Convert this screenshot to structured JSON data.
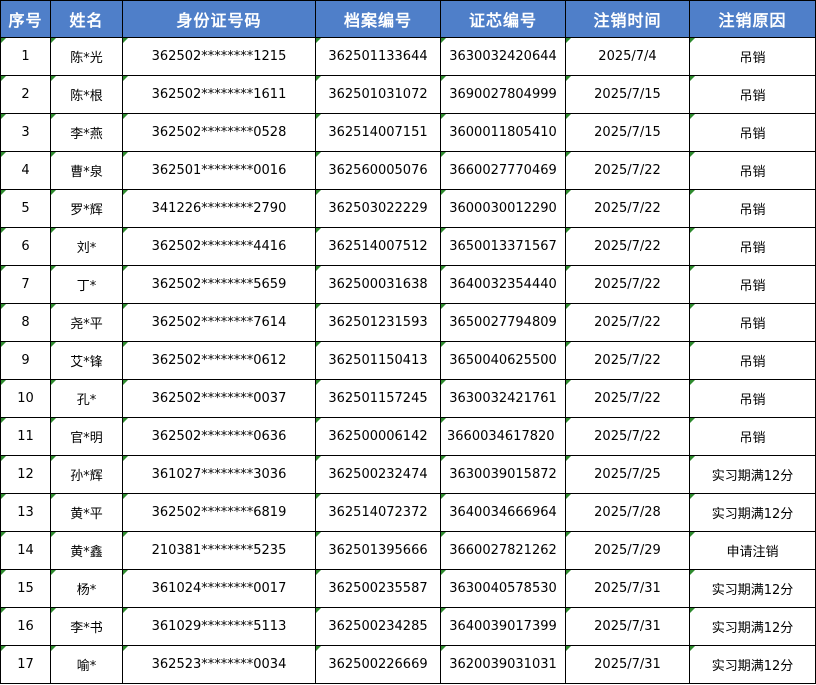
{
  "headers": [
    "序号",
    "姓名",
    "身份证号码",
    "档案编号",
    "证芯编号",
    "注销时间",
    "注销原因"
  ],
  "rows": [
    {
      "no": "1",
      "name": "陈*光",
      "id": "362502********1215",
      "file": "362501133644",
      "chip": "3630032420644",
      "date": "2025/7/4",
      "reason": "吊销"
    },
    {
      "no": "2",
      "name": "陈*根",
      "id": "362502********1611",
      "file": "362501031072",
      "chip": "3690027804999",
      "date": "2025/7/15",
      "reason": "吊销"
    },
    {
      "no": "3",
      "name": "李*燕",
      "id": "362502********0528",
      "file": "362514007151",
      "chip": "3600011805410",
      "date": "2025/7/15",
      "reason": "吊销"
    },
    {
      "no": "4",
      "name": "曹*泉",
      "id": "362501********0016",
      "file": "362560005076",
      "chip": "3660027770469",
      "date": "2025/7/22",
      "reason": "吊销"
    },
    {
      "no": "5",
      "name": "罗*辉",
      "id": "341226********2790",
      "file": "362503022229",
      "chip": "3600030012290",
      "date": "2025/7/22",
      "reason": "吊销"
    },
    {
      "no": "6",
      "name": "刘*",
      "id": "362502********4416",
      "file": "362514007512",
      "chip": "3650013371567",
      "date": "2025/7/22",
      "reason": "吊销"
    },
    {
      "no": "7",
      "name": "丁*",
      "id": "362502********5659",
      "file": "362500031638",
      "chip": "3640032354440",
      "date": "2025/7/22",
      "reason": "吊销"
    },
    {
      "no": "8",
      "name": "尧*平",
      "id": "362502********7614",
      "file": "362501231593",
      "chip": "3650027794809",
      "date": "2025/7/22",
      "reason": "吊销"
    },
    {
      "no": "9",
      "name": "艾*锋",
      "id": "362502********0612",
      "file": "362501150413",
      "chip": "3650040625500",
      "date": "2025/7/22",
      "reason": "吊销"
    },
    {
      "no": "10",
      "name": "孔*",
      "id": "362502********0037",
      "file": "362501157245",
      "chip": "3630032421761",
      "date": "2025/7/22",
      "reason": "吊销"
    },
    {
      "no": "11",
      "name": "官*明",
      "id": "362502********0636",
      "file": "362500006142",
      "chip": "3660034617820",
      "date": "2025/7/22",
      "reason": "吊销"
    },
    {
      "no": "12",
      "name": "孙*辉",
      "id": "361027********3036",
      "file": "362500232474",
      "chip": "3630039015872",
      "date": "2025/7/25",
      "reason": "实习期满12分"
    },
    {
      "no": "13",
      "name": "黄*平",
      "id": "362502********6819",
      "file": "362514072372",
      "chip": "3640034666964",
      "date": "2025/7/28",
      "reason": "实习期满12分"
    },
    {
      "no": "14",
      "name": "黄*鑫",
      "id": "210381********5235",
      "file": "362501395666",
      "chip": "3660027821262",
      "date": "2025/7/29",
      "reason": "申请注销"
    },
    {
      "no": "15",
      "name": "杨*",
      "id": "361024********0017",
      "file": "362500235587",
      "chip": "3630040578530",
      "date": "2025/7/31",
      "reason": "实习期满12分"
    },
    {
      "no": "16",
      "name": "李*书",
      "id": "361029********5113",
      "file": "362500234285",
      "chip": "3640039017399",
      "date": "2025/7/31",
      "reason": "实习期满12分"
    },
    {
      "no": "17",
      "name": "喻*",
      "id": "362523********0034",
      "file": "362500226669",
      "chip": "3620039031031",
      "date": "2025/7/31",
      "reason": "实习期满12分"
    }
  ],
  "colors": {
    "header_bg": "#4f7fc9",
    "header_text": "#ffffff",
    "border": "#000000",
    "cell_marker": "#2e8b2e"
  }
}
